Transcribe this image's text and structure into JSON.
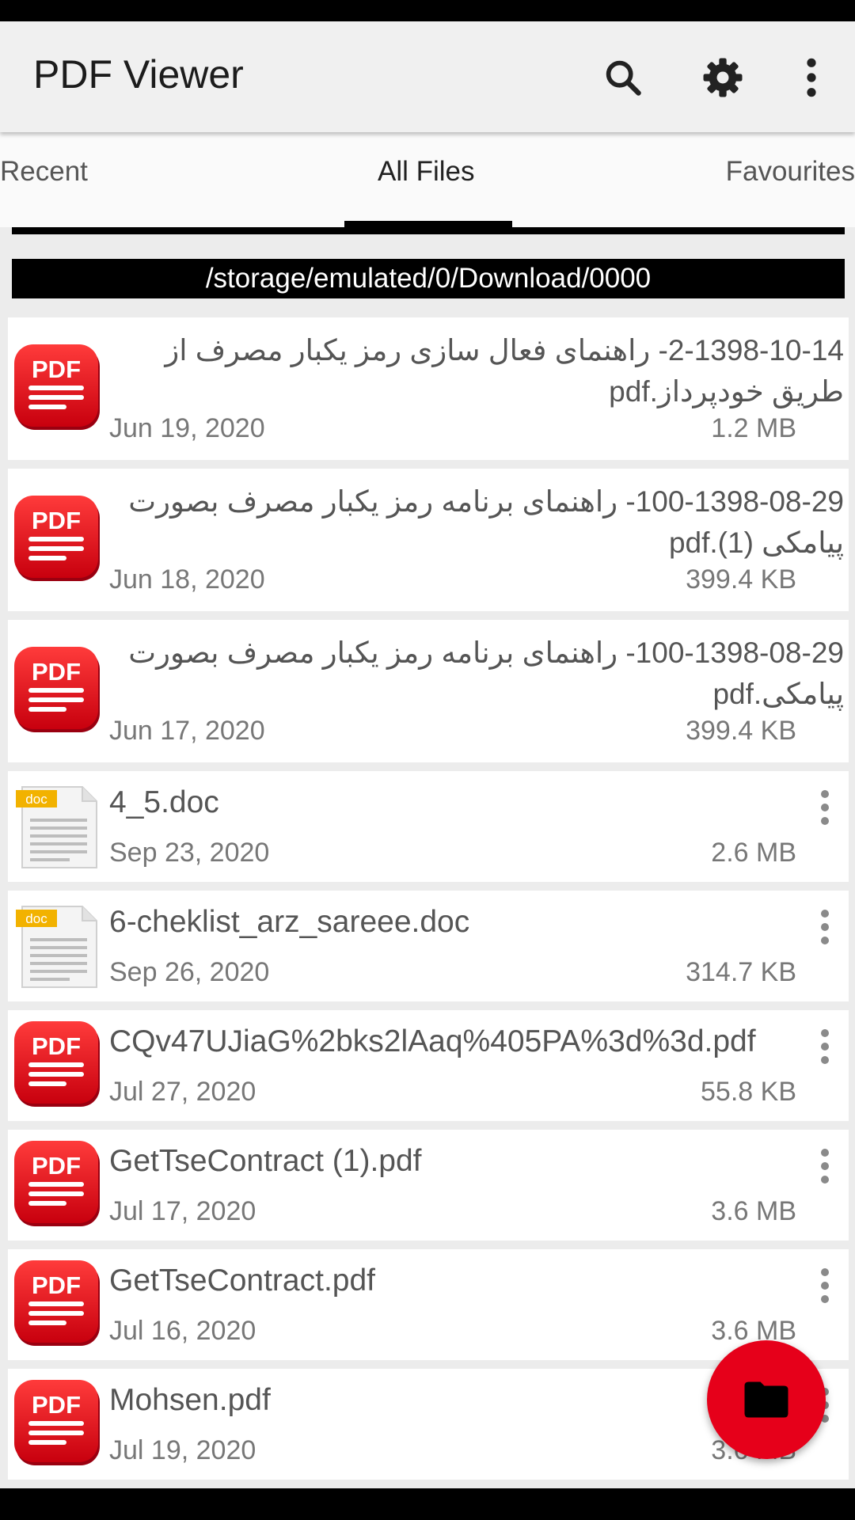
{
  "app": {
    "title": "PDF Viewer"
  },
  "toolbar": {
    "search_icon": "search-icon",
    "settings_icon": "gear-icon",
    "more_icon": "more-vertical-icon"
  },
  "tabs": [
    {
      "label": "Recent"
    },
    {
      "label": "All Files",
      "selected": true
    },
    {
      "label": "Favourites"
    }
  ],
  "path": "/storage/emulated/0/Download/0000",
  "files": [
    {
      "name": "2-1398-10-14- راهنمای فعال سازی رمز یکبار مصرف از طریق خودپرداز.pdf",
      "date": "Jun 19, 2020",
      "size": "1.2 MB",
      "type": "pdf"
    },
    {
      "name": "100-1398-08-29- راهنمای برنامه رمز یکبار مصرف بصورت پیامکی (1).pdf",
      "date": "Jun 18, 2020",
      "size": "399.4 KB",
      "type": "pdf"
    },
    {
      "name": "100-1398-08-29- راهنمای برنامه رمز یکبار مصرف بصورت پیامکی.pdf",
      "date": "Jun 17, 2020",
      "size": "399.4 KB",
      "type": "pdf"
    },
    {
      "name": "4_5.doc",
      "date": "Sep 23, 2020",
      "size": "2.6 MB",
      "type": "doc"
    },
    {
      "name": "6-cheklist_arz_sareee.doc",
      "date": "Sep 26, 2020",
      "size": "314.7 KB",
      "type": "doc"
    },
    {
      "name": "CQv47UJiaG%2bks2lAaq%405PA%3d%3d.pdf",
      "date": "Jul 27, 2020",
      "size": "55.8 KB",
      "type": "pdf"
    },
    {
      "name": "GetTseContract (1).pdf",
      "date": "Jul 17, 2020",
      "size": "3.6 MB",
      "type": "pdf"
    },
    {
      "name": "GetTseContract.pdf",
      "date": "Jul 16, 2020",
      "size": "3.6 MB",
      "type": "pdf"
    },
    {
      "name": "Mohsen.pdf",
      "date": "Jul 19, 2020",
      "size": "3.6 MB",
      "type": "pdf"
    }
  ],
  "icons": {
    "pdf_label": "PDF",
    "doc_label": "doc",
    "fab_icon": "folder-icon"
  },
  "colors": {
    "pdf_red": "#e30d1b",
    "fab_red": "#e6001a",
    "doc_badge": "#f2b200"
  }
}
